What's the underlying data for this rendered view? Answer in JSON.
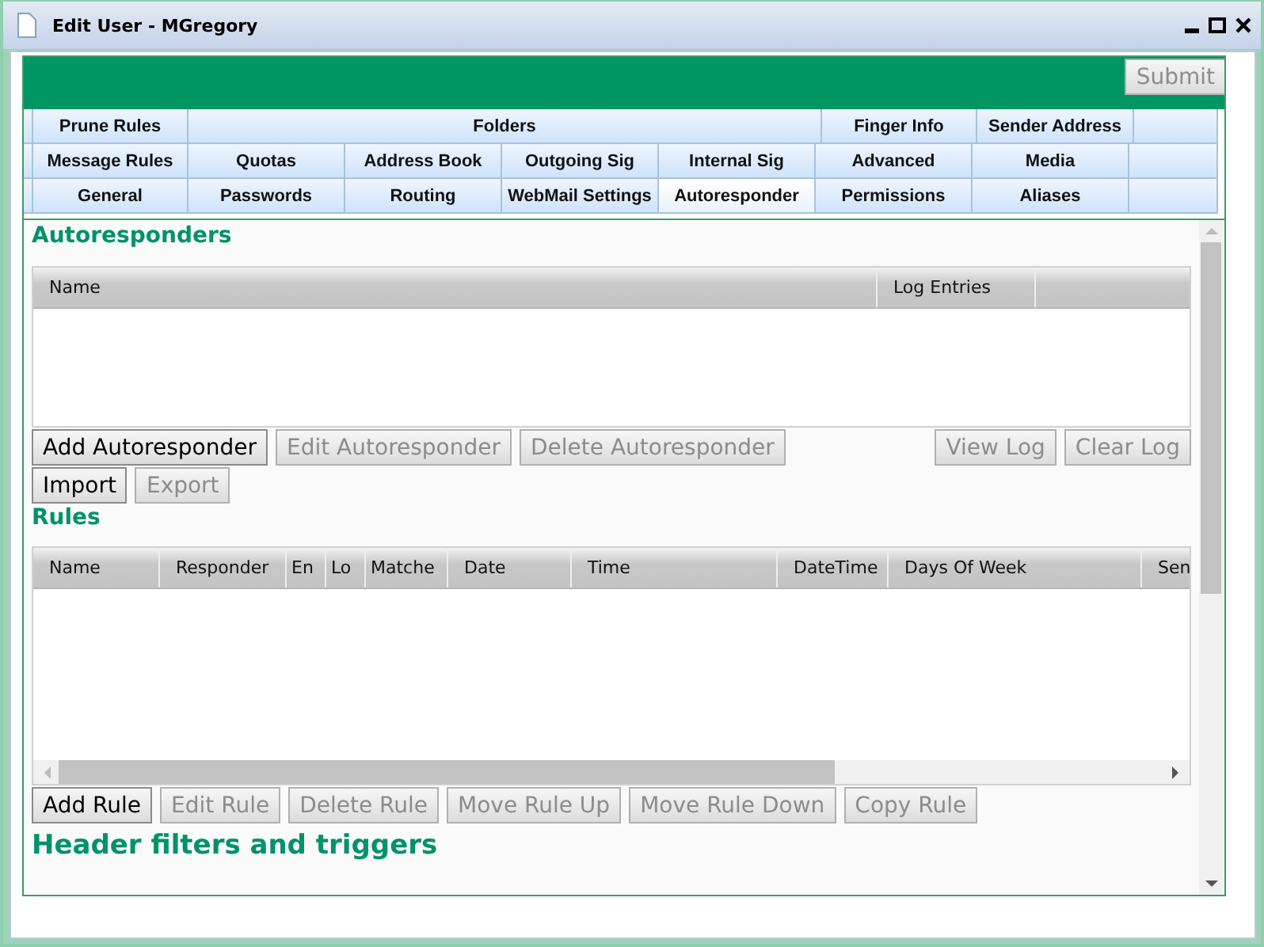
{
  "window": {
    "title": "Edit User - MGregory"
  },
  "submit_button": {
    "label": "Submit",
    "disabled": true
  },
  "tab_rows": [
    {
      "tabs": [
        {
          "label": "Prune Rules",
          "selected": false
        },
        {
          "label": "Folders",
          "selected": false
        },
        {
          "label": "Finger Info",
          "selected": false
        },
        {
          "label": "Sender Address",
          "selected": false
        }
      ]
    },
    {
      "tabs": [
        {
          "label": "Message Rules",
          "selected": false
        },
        {
          "label": "Quotas",
          "selected": false
        },
        {
          "label": "Address Book",
          "selected": false
        },
        {
          "label": "Outgoing Sig",
          "selected": false
        },
        {
          "label": "Internal Sig",
          "selected": false
        },
        {
          "label": "Advanced",
          "selected": false
        },
        {
          "label": "Media",
          "selected": false
        }
      ]
    },
    {
      "tabs": [
        {
          "label": "General",
          "selected": false
        },
        {
          "label": "Passwords",
          "selected": false
        },
        {
          "label": "Routing",
          "selected": false
        },
        {
          "label": "WebMail Settings",
          "selected": false
        },
        {
          "label": "Autoresponder",
          "selected": true
        },
        {
          "label": "Permissions",
          "selected": false
        },
        {
          "label": "Aliases",
          "selected": false
        }
      ]
    }
  ],
  "autoresponders": {
    "heading": "Autoresponders",
    "columns": [
      "Name",
      "Log Entries"
    ],
    "button_rows": [
      {
        "left": [
          {
            "label": "Add Autoresponder",
            "disabled": false
          },
          {
            "label": "Edit Autoresponder",
            "disabled": true
          },
          {
            "label": "Delete Autoresponder",
            "disabled": true
          }
        ],
        "right": [
          {
            "label": "View Log",
            "disabled": true
          },
          {
            "label": "Clear Log",
            "disabled": true
          }
        ]
      },
      {
        "left": [
          {
            "label": "Import",
            "disabled": false
          },
          {
            "label": "Export",
            "disabled": true
          }
        ],
        "right": []
      }
    ]
  },
  "rules": {
    "heading": "Rules",
    "columns": [
      "Name",
      "Responder",
      "En",
      "Lo",
      "Matche",
      "Date",
      "Time",
      "DateTime",
      "Days Of Week",
      "Sen"
    ],
    "buttons": [
      {
        "label": "Add Rule",
        "disabled": false
      },
      {
        "label": "Edit Rule",
        "disabled": true
      },
      {
        "label": "Delete Rule",
        "disabled": true
      },
      {
        "label": "Move Rule Up",
        "disabled": true
      },
      {
        "label": "Move Rule Down",
        "disabled": true
      },
      {
        "label": "Copy Rule",
        "disabled": true
      }
    ]
  },
  "header_filters": {
    "heading": "Header filters and triggers"
  }
}
